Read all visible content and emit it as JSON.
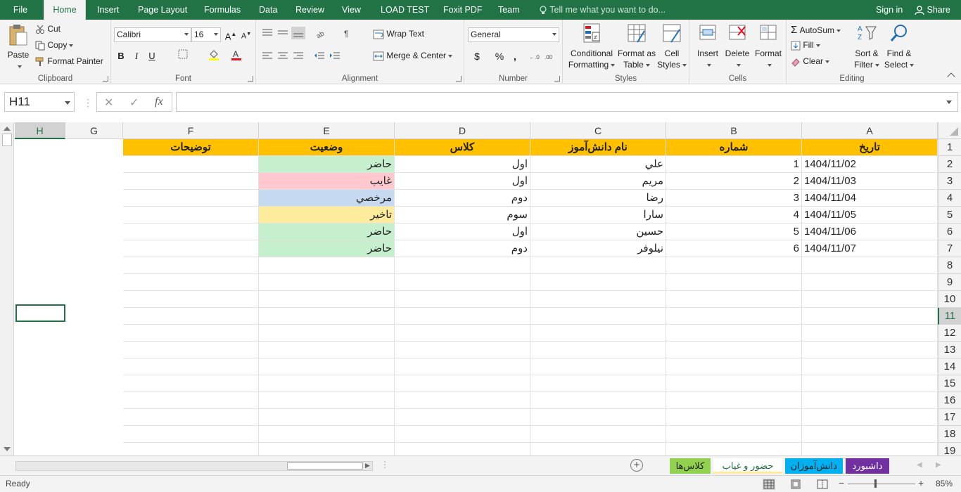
{
  "menu": {
    "tabs": [
      "File",
      "Home",
      "Insert",
      "Page Layout",
      "Formulas",
      "Data",
      "Review",
      "View",
      "LOAD TEST",
      "Foxit PDF",
      "Team"
    ],
    "active_tab": "Home",
    "tell_me": "Tell me what you want to do...",
    "sign_in": "Sign in",
    "share": "Share"
  },
  "ribbon": {
    "clipboard": {
      "label": "Clipboard",
      "paste": "Paste",
      "cut": "Cut",
      "copy": "Copy",
      "format_painter": "Format Painter"
    },
    "font": {
      "label": "Font",
      "name": "Calibri",
      "size": "16",
      "bold": "B",
      "italic": "I",
      "underline": "U"
    },
    "alignment": {
      "label": "Alignment",
      "wrap_text": "Wrap Text",
      "merge_center": "Merge & Center"
    },
    "number": {
      "label": "Number",
      "format": "General",
      "currency": "$",
      "percent": "%",
      "comma": ","
    },
    "styles": {
      "label": "Styles",
      "conditional_1": "Conditional",
      "conditional_2": "Formatting",
      "format_table_1": "Format as",
      "format_table_2": "Table",
      "cell_styles_1": "Cell",
      "cell_styles_2": "Styles"
    },
    "cells": {
      "label": "Cells",
      "insert": "Insert",
      "delete": "Delete",
      "format": "Format"
    },
    "editing": {
      "label": "Editing",
      "autosum": "AutoSum",
      "fill": "Fill",
      "clear": "Clear",
      "sort_1": "Sort &",
      "sort_2": "Filter",
      "find_1": "Find &",
      "find_2": "Select"
    }
  },
  "formula_bar": {
    "name_box": "H11",
    "formula": ""
  },
  "grid": {
    "columns": [
      "H",
      "G",
      "F",
      "E",
      "D",
      "C",
      "B",
      "A"
    ],
    "selected_column": "H",
    "selected_row": "11",
    "rows": [
      "1",
      "2",
      "3",
      "4",
      "5",
      "6",
      "7",
      "8",
      "9",
      "10",
      "11",
      "12",
      "13",
      "14",
      "15",
      "16",
      "17",
      "18",
      "19"
    ],
    "headers": {
      "A": "تاریخ",
      "B": "شماره",
      "C": "نام دانش‌آموز",
      "D": "کلاس",
      "E": "وضعیت",
      "F": "توضیحات"
    },
    "records": [
      {
        "date": "1404/11/02",
        "num": "1",
        "name": "علي",
        "class": "اول",
        "status": "حاضر"
      },
      {
        "date": "1404/11/03",
        "num": "2",
        "name": "مريم",
        "class": "اول",
        "status": "غايب"
      },
      {
        "date": "1404/11/04",
        "num": "3",
        "name": "رضا",
        "class": "دوم",
        "status": "مرخصي"
      },
      {
        "date": "1404/11/05",
        "num": "4",
        "name": "سارا",
        "class": "سوم",
        "status": "تاخير"
      },
      {
        "date": "1404/11/06",
        "num": "5",
        "name": "حسين",
        "class": "اول",
        "status": "حاضر"
      },
      {
        "date": "1404/11/07",
        "num": "6",
        "name": "نيلوفر",
        "class": "دوم",
        "status": "حاضر"
      }
    ],
    "status_colors": {
      "حاضر": "#c6efce",
      "غايب": "#ffc7ce",
      "مرخصي": "#c5d9f1",
      "تاخير": "#ffeb9c"
    }
  },
  "sheets": [
    {
      "name": "کلاس‌ها",
      "color": "#92d050"
    },
    {
      "name": "حضور و غیاب",
      "color": "#ffeb9c",
      "active": true
    },
    {
      "name": "دانش‌آموزان",
      "color": "#00b0f0"
    },
    {
      "name": "داشبورد",
      "color": "#7030a0"
    }
  ],
  "status_bar": {
    "status": "Ready",
    "zoom": "85%"
  }
}
